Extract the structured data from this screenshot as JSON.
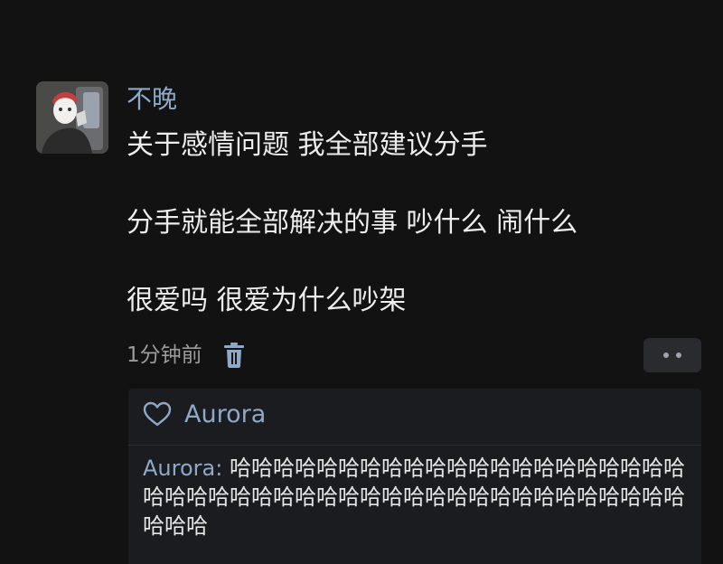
{
  "post": {
    "author": "不晚",
    "lines": [
      "关于感情问题 我全部建议分手",
      "分手就能全部解决的事 吵什么 闹什么",
      "很爱吗 很爱为什么吵架"
    ],
    "time": "1分钟前"
  },
  "likes": {
    "names": "Aurora"
  },
  "comment": {
    "author": "Aurora: ",
    "text": "哈哈哈哈哈哈哈哈哈哈哈哈哈哈哈哈哈哈哈哈哈哈哈哈哈哈哈哈哈哈哈哈哈哈哈哈哈哈哈哈哈哈哈哈哈哈哈哈哈"
  },
  "icons": {
    "avatar": "avatar-image",
    "trash": "trash-icon",
    "more": "more-icon",
    "heart": "heart-icon"
  },
  "colors": {
    "background": "#121212",
    "name": "#8ea9c8",
    "text": "#ededed",
    "muted": "#9b9b9b",
    "panel": "#1b1c1f"
  }
}
